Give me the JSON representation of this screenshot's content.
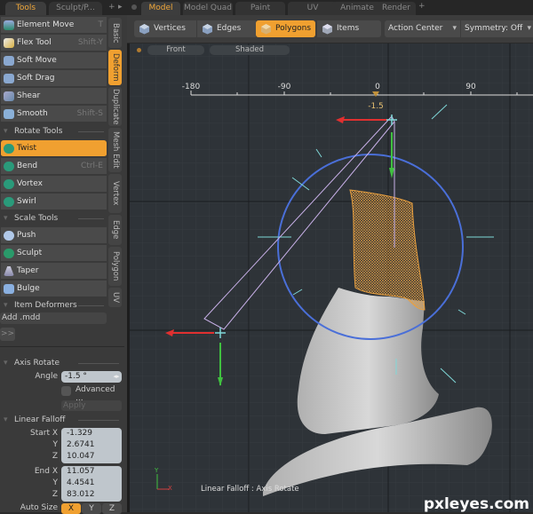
{
  "left_tabs": [
    {
      "label": "Tools",
      "active": true
    },
    {
      "label": "Sculpt/P...",
      "active": false
    }
  ],
  "left_tabs_add": "+",
  "left_tabs_more": "▸",
  "tools": {
    "deform_items": [
      {
        "label": "Element Move",
        "shortcut": "T",
        "icon": "element-move-icon"
      },
      {
        "label": "Flex Tool",
        "shortcut": "Shift-Y",
        "icon": "flex-tool-icon"
      },
      {
        "label": "Soft Move",
        "shortcut": "",
        "icon": "soft-move-icon"
      },
      {
        "label": "Soft Drag",
        "shortcut": "",
        "icon": "soft-drag-icon"
      },
      {
        "label": "Shear",
        "shortcut": "",
        "icon": "shear-icon"
      },
      {
        "label": "Smooth",
        "shortcut": "Shift-S",
        "icon": "smooth-icon"
      }
    ],
    "rotate_group": "Rotate Tools",
    "rotate_items": [
      {
        "label": "Twist",
        "shortcut": "",
        "icon": "twist-icon",
        "selected": true
      },
      {
        "label": "Bend",
        "shortcut": "Ctrl-E",
        "icon": "bend-icon"
      },
      {
        "label": "Vortex",
        "shortcut": "",
        "icon": "vortex-icon"
      },
      {
        "label": "Swirl",
        "shortcut": "",
        "icon": "swirl-icon"
      }
    ],
    "scale_group": "Scale Tools",
    "scale_items": [
      {
        "label": "Push",
        "icon": "push-icon"
      },
      {
        "label": "Sculpt",
        "icon": "sculpt-icon"
      },
      {
        "label": "Taper",
        "icon": "taper-icon"
      },
      {
        "label": "Bulge",
        "icon": "bulge-icon"
      }
    ],
    "item_deformers_group": "Item Deformers",
    "add_mdd": "Add .mdd",
    "expand": ">>"
  },
  "vertical_tabs": [
    "Basic",
    "Deform",
    "Duplicate",
    "Mesh Edit",
    "Vertex",
    "Edge",
    "Polygon",
    "UV"
  ],
  "vertical_tab_active": "Deform",
  "axis_rotate": {
    "title": "Axis Rotate",
    "angle_label": "Angle",
    "angle_value": "-1.5 °",
    "advanced_label": "Advanced ...",
    "apply_label": "Apply"
  },
  "linear_falloff": {
    "title": "Linear Falloff",
    "start_x_label": "Start X",
    "start_x": "-1.329",
    "start_y_label": "Y",
    "start_y": "2.6741",
    "start_z_label": "Z",
    "start_z": "10.047",
    "end_x_label": "End X",
    "end_x": "11.057",
    "end_y_label": "Y",
    "end_y": "4.4541",
    "end_z_label": "Z",
    "end_z": "83.012",
    "auto_size_label": "Auto Size",
    "auto_size_options": [
      "X",
      "Y",
      "Z"
    ],
    "auto_size_active": "X"
  },
  "top_tabs": [
    {
      "label": "Model",
      "active": true
    },
    {
      "label": "Model Quad"
    },
    {
      "label": "Paint"
    },
    {
      "label": "UV"
    },
    {
      "label": "Animate"
    },
    {
      "label": "Render"
    }
  ],
  "top_tabs_add": "+",
  "mode_buttons": [
    {
      "label": "Vertices",
      "selected": false
    },
    {
      "label": "Edges",
      "selected": false
    },
    {
      "label": "Polygons",
      "selected": true
    },
    {
      "label": "Items",
      "selected": false
    }
  ],
  "action_center": "Action Center",
  "symmetry": "Symmetry: Off",
  "viewport": {
    "view": "Front",
    "shading": "Shaded",
    "ruler_ticks": [
      "-180",
      "-90",
      "0",
      "90"
    ],
    "angle_readout": "-1.5",
    "status": "Linear Falloff : Axis Rotate",
    "axis_y": "Y",
    "axis_x": "X",
    "watermark": "pxleyes.com"
  },
  "colors": {
    "accent": "#f0a030",
    "falloff_circle": "#4a6fd8",
    "wireframe": "#e8a040",
    "handle_red": "#e03030",
    "handle_green": "#40c040",
    "handle_cyan": "#7fd8d8",
    "falloff_lines": "#c8b0e8"
  }
}
